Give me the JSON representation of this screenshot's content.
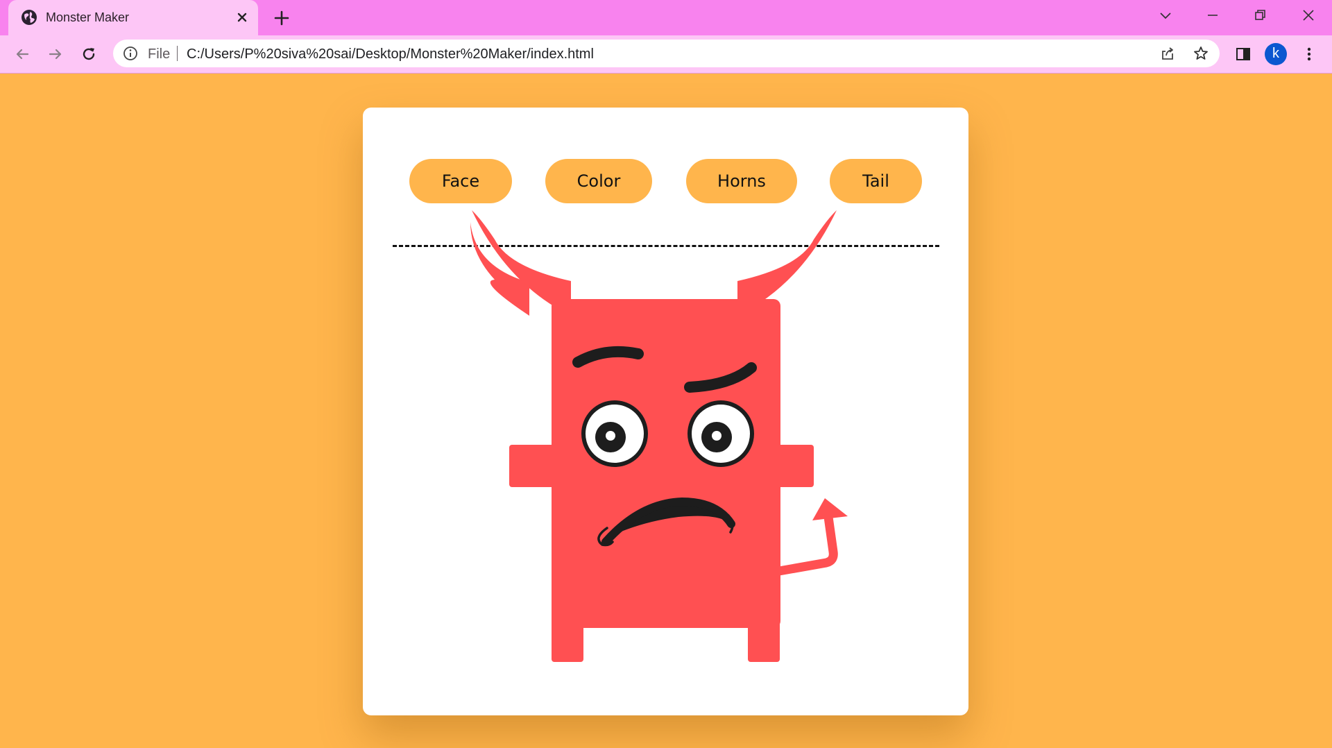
{
  "browser": {
    "tab_title": "Monster Maker",
    "file_label": "File",
    "url": "C:/Users/P%20siva%20sai/Desktop/Monster%20Maker/index.html",
    "profile_initial": "k"
  },
  "app": {
    "buttons": [
      {
        "label": "Face"
      },
      {
        "label": "Color"
      },
      {
        "label": "Horns"
      },
      {
        "label": "Tail"
      }
    ]
  },
  "colors": {
    "page_background": "#ffb54c",
    "button_background": "#ffb54c",
    "monster_body": "#ff5052",
    "tab_strip": "#f883ee",
    "toolbar": "#fdc6f6"
  }
}
